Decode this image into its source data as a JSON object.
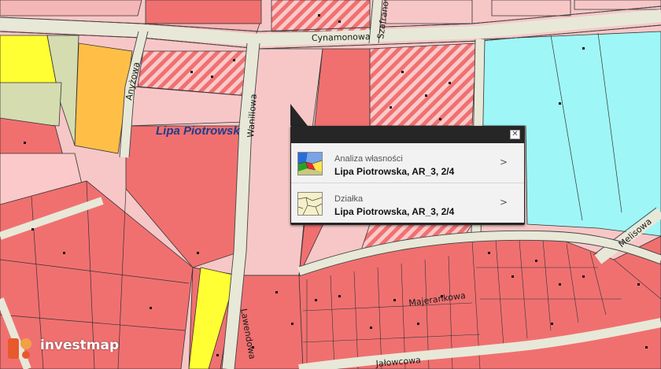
{
  "map": {
    "place_name": "Lipa Piotrowsk",
    "streets": {
      "cynamonowa": "Cynamonowa",
      "szafranowa": "Szafranowa",
      "anyzowa": "Anyżowa",
      "waniliowa": "Waniliowa",
      "lawendowa": "Lawendowa",
      "majerankowa": "Majerankowa",
      "jalowcowa": "Jałowcowa",
      "melisowa": "Melisowa"
    },
    "colors": {
      "dense_residential": "#f07070",
      "residential": "#f7c7c7",
      "services": "#ffbf47",
      "agricultural": "#ffff33",
      "water_green": "#9ff6f6",
      "meadow": "#d4dcb0",
      "road": "#e8e8d8"
    }
  },
  "popup": {
    "close_label": "✕",
    "items": [
      {
        "subtitle": "Analiza własności",
        "title": "Lipa Piotrowska, AR_3, 2/4",
        "icon": "ownership-analysis-icon"
      },
      {
        "subtitle": "Działka",
        "title": "Lipa Piotrowska, AR_3, 2/4",
        "icon": "parcel-icon"
      }
    ],
    "arrow": ">"
  },
  "brand": {
    "name": "investmap",
    "icon": "investmap-logo-icon"
  }
}
